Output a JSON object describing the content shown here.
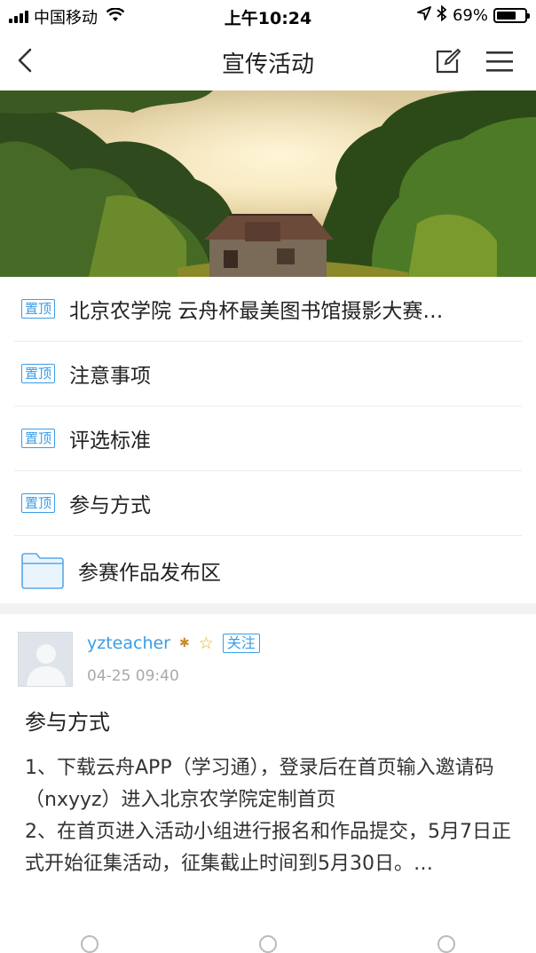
{
  "status_bar": {
    "carrier": "中国移动",
    "time": "上午10:24",
    "battery_percent": "69%",
    "battery_level": 0.69
  },
  "nav": {
    "title": "宣传活动",
    "back_icon": "chevron-left-icon",
    "edit_icon": "compose-icon",
    "menu_icon": "menu-icon"
  },
  "list": {
    "tag_label": "置顶",
    "items": [
      {
        "label": "北京农学院 云舟杯最美图书馆摄影大赛…"
      },
      {
        "label": "注意事项"
      },
      {
        "label": "评选标准"
      },
      {
        "label": "参与方式"
      }
    ],
    "folder": {
      "label": "参赛作品发布区",
      "icon": "folder-icon"
    }
  },
  "post": {
    "author": "yzteacher",
    "follow_label": "关注",
    "time": "04-25 09:40",
    "title": "参与方式",
    "body": "1、下载云舟APP（学习通），登录后在首页输入邀请码（nxyyz）进入北京农学院定制首页\n2、在首页进入活动小组进行报名和作品提交，5月7日正式开始征集活动，征集截止时间到5月30日。…"
  },
  "colors": {
    "accent": "#3b9de6",
    "divider": "#f2f2f4",
    "time_gray": "#a9a9a9"
  }
}
